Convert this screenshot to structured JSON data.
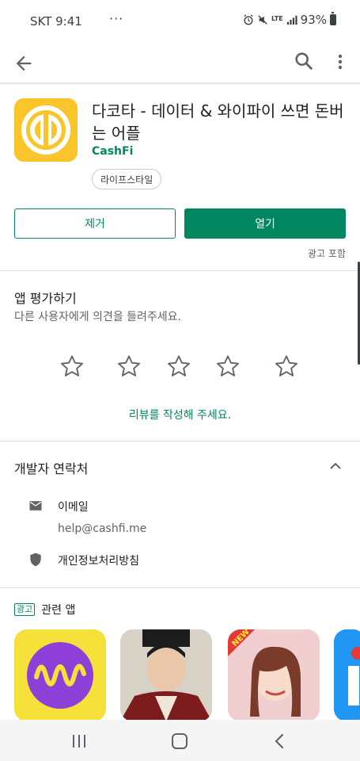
{
  "status_bar": {
    "carrier_time": "SKT 9:41",
    "dots": "···",
    "network": "LTE",
    "battery": "93%"
  },
  "app": {
    "title": "다코타 - 데이터 & 와이파이 쓰면 돈버는 어플",
    "developer": "CashFi",
    "category": "라이프스타일",
    "remove_label": "제거",
    "open_label": "열기",
    "ad_note": "광고 포함",
    "icon_color": "#f9c52b"
  },
  "rating": {
    "title": "앱 평가하기",
    "subtitle": "다른 사용자에게 의견을 들려주세요.",
    "write_review": "리뷰를 작성해 주세요.",
    "stars_count": 5
  },
  "developer_contact": {
    "title": "개발자 연락처",
    "email_label": "이메일",
    "email_value": "help@cashfi.me",
    "privacy_label": "개인정보처리방침"
  },
  "related": {
    "ad_badge": "광고",
    "title": "관련 앱",
    "apps": [
      {
        "icon": "purple-wave-icon",
        "color": "#f6e03a"
      },
      {
        "icon": "drama-character-icon",
        "color": "#c9c2b8"
      },
      {
        "icon": "new-idol-game-icon",
        "color": "#e7b3b6",
        "badge": "NEW"
      },
      {
        "icon": "blue-app-icon",
        "color": "#2196f3"
      }
    ]
  },
  "colors": {
    "accent": "#01875f",
    "text_primary": "#202124",
    "text_secondary": "#5f6368"
  }
}
